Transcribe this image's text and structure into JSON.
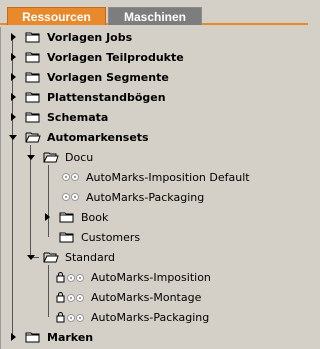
{
  "tabs": [
    {
      "label": "Ressourcen",
      "active": true
    },
    {
      "label": "Maschinen",
      "active": false
    }
  ],
  "tree": {
    "vorlagen_jobs": "Vorlagen Jobs",
    "vorlagen_teilprodukte": "Vorlagen Teilprodukte",
    "vorlagen_segmente": "Vorlagen Segmente",
    "plattenstandboegen": "Plattenstandbögen",
    "schemata": "Schemata",
    "automarkensets": "Automarkensets",
    "docu": "Docu",
    "docu_children": [
      "AutoMarks-Imposition Default",
      "AutoMarks-Packaging",
      "Book",
      "Customers"
    ],
    "standard": "Standard",
    "standard_children": [
      "AutoMarks-Imposition",
      "AutoMarks-Montage",
      "AutoMarks-Packaging"
    ],
    "marken": "Marken"
  },
  "colors": {
    "accent": "#e8892b",
    "inactive_tab": "#7d7d7d",
    "background": "#d4d0c8"
  }
}
